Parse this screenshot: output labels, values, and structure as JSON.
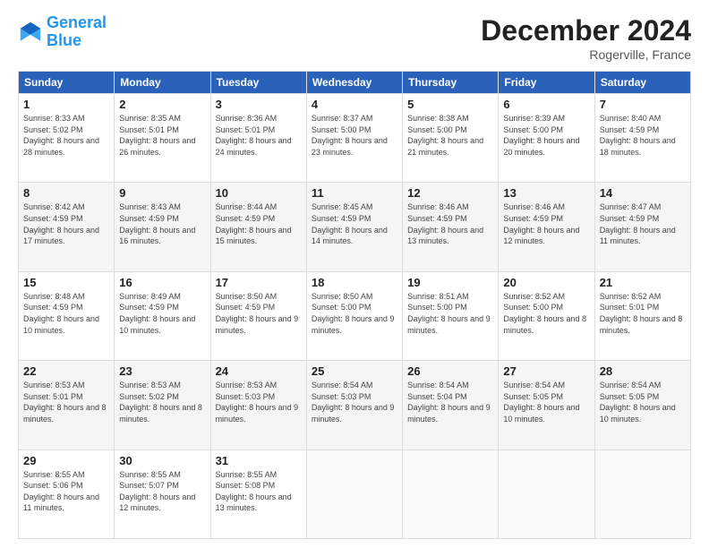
{
  "logo": {
    "line1": "General",
    "line2": "Blue"
  },
  "title": "December 2024",
  "subtitle": "Rogerville, France",
  "headers": [
    "Sunday",
    "Monday",
    "Tuesday",
    "Wednesday",
    "Thursday",
    "Friday",
    "Saturday"
  ],
  "weeks": [
    [
      {
        "day": "1",
        "sunrise": "Sunrise: 8:33 AM",
        "sunset": "Sunset: 5:02 PM",
        "daylight": "Daylight: 8 hours and 28 minutes."
      },
      {
        "day": "2",
        "sunrise": "Sunrise: 8:35 AM",
        "sunset": "Sunset: 5:01 PM",
        "daylight": "Daylight: 8 hours and 26 minutes."
      },
      {
        "day": "3",
        "sunrise": "Sunrise: 8:36 AM",
        "sunset": "Sunset: 5:01 PM",
        "daylight": "Daylight: 8 hours and 24 minutes."
      },
      {
        "day": "4",
        "sunrise": "Sunrise: 8:37 AM",
        "sunset": "Sunset: 5:00 PM",
        "daylight": "Daylight: 8 hours and 23 minutes."
      },
      {
        "day": "5",
        "sunrise": "Sunrise: 8:38 AM",
        "sunset": "Sunset: 5:00 PM",
        "daylight": "Daylight: 8 hours and 21 minutes."
      },
      {
        "day": "6",
        "sunrise": "Sunrise: 8:39 AM",
        "sunset": "Sunset: 5:00 PM",
        "daylight": "Daylight: 8 hours and 20 minutes."
      },
      {
        "day": "7",
        "sunrise": "Sunrise: 8:40 AM",
        "sunset": "Sunset: 4:59 PM",
        "daylight": "Daylight: 8 hours and 18 minutes."
      }
    ],
    [
      {
        "day": "8",
        "sunrise": "Sunrise: 8:42 AM",
        "sunset": "Sunset: 4:59 PM",
        "daylight": "Daylight: 8 hours and 17 minutes."
      },
      {
        "day": "9",
        "sunrise": "Sunrise: 8:43 AM",
        "sunset": "Sunset: 4:59 PM",
        "daylight": "Daylight: 8 hours and 16 minutes."
      },
      {
        "day": "10",
        "sunrise": "Sunrise: 8:44 AM",
        "sunset": "Sunset: 4:59 PM",
        "daylight": "Daylight: 8 hours and 15 minutes."
      },
      {
        "day": "11",
        "sunrise": "Sunrise: 8:45 AM",
        "sunset": "Sunset: 4:59 PM",
        "daylight": "Daylight: 8 hours and 14 minutes."
      },
      {
        "day": "12",
        "sunrise": "Sunrise: 8:46 AM",
        "sunset": "Sunset: 4:59 PM",
        "daylight": "Daylight: 8 hours and 13 minutes."
      },
      {
        "day": "13",
        "sunrise": "Sunrise: 8:46 AM",
        "sunset": "Sunset: 4:59 PM",
        "daylight": "Daylight: 8 hours and 12 minutes."
      },
      {
        "day": "14",
        "sunrise": "Sunrise: 8:47 AM",
        "sunset": "Sunset: 4:59 PM",
        "daylight": "Daylight: 8 hours and 11 minutes."
      }
    ],
    [
      {
        "day": "15",
        "sunrise": "Sunrise: 8:48 AM",
        "sunset": "Sunset: 4:59 PM",
        "daylight": "Daylight: 8 hours and 10 minutes."
      },
      {
        "day": "16",
        "sunrise": "Sunrise: 8:49 AM",
        "sunset": "Sunset: 4:59 PM",
        "daylight": "Daylight: 8 hours and 10 minutes."
      },
      {
        "day": "17",
        "sunrise": "Sunrise: 8:50 AM",
        "sunset": "Sunset: 4:59 PM",
        "daylight": "Daylight: 8 hours and 9 minutes."
      },
      {
        "day": "18",
        "sunrise": "Sunrise: 8:50 AM",
        "sunset": "Sunset: 5:00 PM",
        "daylight": "Daylight: 8 hours and 9 minutes."
      },
      {
        "day": "19",
        "sunrise": "Sunrise: 8:51 AM",
        "sunset": "Sunset: 5:00 PM",
        "daylight": "Daylight: 8 hours and 9 minutes."
      },
      {
        "day": "20",
        "sunrise": "Sunrise: 8:52 AM",
        "sunset": "Sunset: 5:00 PM",
        "daylight": "Daylight: 8 hours and 8 minutes."
      },
      {
        "day": "21",
        "sunrise": "Sunrise: 8:52 AM",
        "sunset": "Sunset: 5:01 PM",
        "daylight": "Daylight: 8 hours and 8 minutes."
      }
    ],
    [
      {
        "day": "22",
        "sunrise": "Sunrise: 8:53 AM",
        "sunset": "Sunset: 5:01 PM",
        "daylight": "Daylight: 8 hours and 8 minutes."
      },
      {
        "day": "23",
        "sunrise": "Sunrise: 8:53 AM",
        "sunset": "Sunset: 5:02 PM",
        "daylight": "Daylight: 8 hours and 8 minutes."
      },
      {
        "day": "24",
        "sunrise": "Sunrise: 8:53 AM",
        "sunset": "Sunset: 5:03 PM",
        "daylight": "Daylight: 8 hours and 9 minutes."
      },
      {
        "day": "25",
        "sunrise": "Sunrise: 8:54 AM",
        "sunset": "Sunset: 5:03 PM",
        "daylight": "Daylight: 8 hours and 9 minutes."
      },
      {
        "day": "26",
        "sunrise": "Sunrise: 8:54 AM",
        "sunset": "Sunset: 5:04 PM",
        "daylight": "Daylight: 8 hours and 9 minutes."
      },
      {
        "day": "27",
        "sunrise": "Sunrise: 8:54 AM",
        "sunset": "Sunset: 5:05 PM",
        "daylight": "Daylight: 8 hours and 10 minutes."
      },
      {
        "day": "28",
        "sunrise": "Sunrise: 8:54 AM",
        "sunset": "Sunset: 5:05 PM",
        "daylight": "Daylight: 8 hours and 10 minutes."
      }
    ],
    [
      {
        "day": "29",
        "sunrise": "Sunrise: 8:55 AM",
        "sunset": "Sunset: 5:06 PM",
        "daylight": "Daylight: 8 hours and 11 minutes."
      },
      {
        "day": "30",
        "sunrise": "Sunrise: 8:55 AM",
        "sunset": "Sunset: 5:07 PM",
        "daylight": "Daylight: 8 hours and 12 minutes."
      },
      {
        "day": "31",
        "sunrise": "Sunrise: 8:55 AM",
        "sunset": "Sunset: 5:08 PM",
        "daylight": "Daylight: 8 hours and 13 minutes."
      },
      null,
      null,
      null,
      null
    ]
  ]
}
